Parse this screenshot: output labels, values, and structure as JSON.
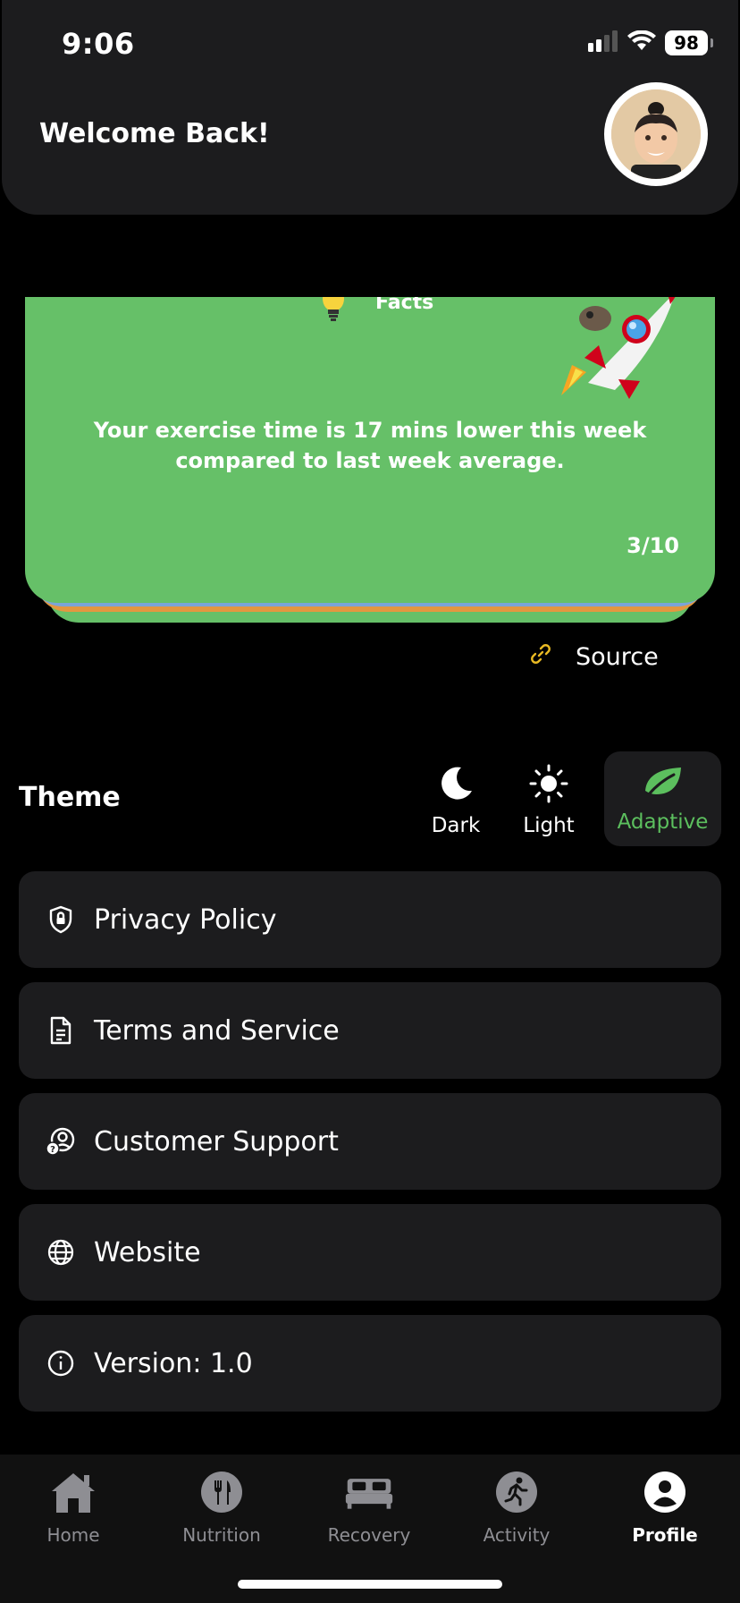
{
  "status_bar": {
    "time": "9:06",
    "battery": "98"
  },
  "header": {
    "welcome": "Welcome Back!"
  },
  "fact_card": {
    "label": "Facts",
    "text": "Your exercise time is 17 mins lower this week compared to last week average.",
    "counter": "3/10",
    "color": "#66c068"
  },
  "source": {
    "label": "Source"
  },
  "theme": {
    "label": "Theme",
    "options": [
      {
        "label": "Dark",
        "icon": "moon-icon"
      },
      {
        "label": "Light",
        "icon": "sun-icon"
      },
      {
        "label": "Adaptive",
        "icon": "leaf-icon",
        "selected": true
      }
    ],
    "accent": "#5cbf5e"
  },
  "menu": [
    {
      "label": "Privacy Policy",
      "icon": "shield-lock-icon"
    },
    {
      "label": "Terms and Service",
      "icon": "document-icon"
    },
    {
      "label": "Customer Support",
      "icon": "support-user-icon"
    },
    {
      "label": "Website",
      "icon": "globe-icon"
    },
    {
      "label": "Version: 1.0",
      "icon": "info-icon"
    }
  ],
  "tabs": [
    {
      "label": "Home",
      "icon": "home-icon"
    },
    {
      "label": "Nutrition",
      "icon": "fork-knife-icon"
    },
    {
      "label": "Recovery",
      "icon": "bed-icon"
    },
    {
      "label": "Activity",
      "icon": "running-icon"
    },
    {
      "label": "Profile",
      "icon": "profile-icon",
      "active": true
    }
  ]
}
